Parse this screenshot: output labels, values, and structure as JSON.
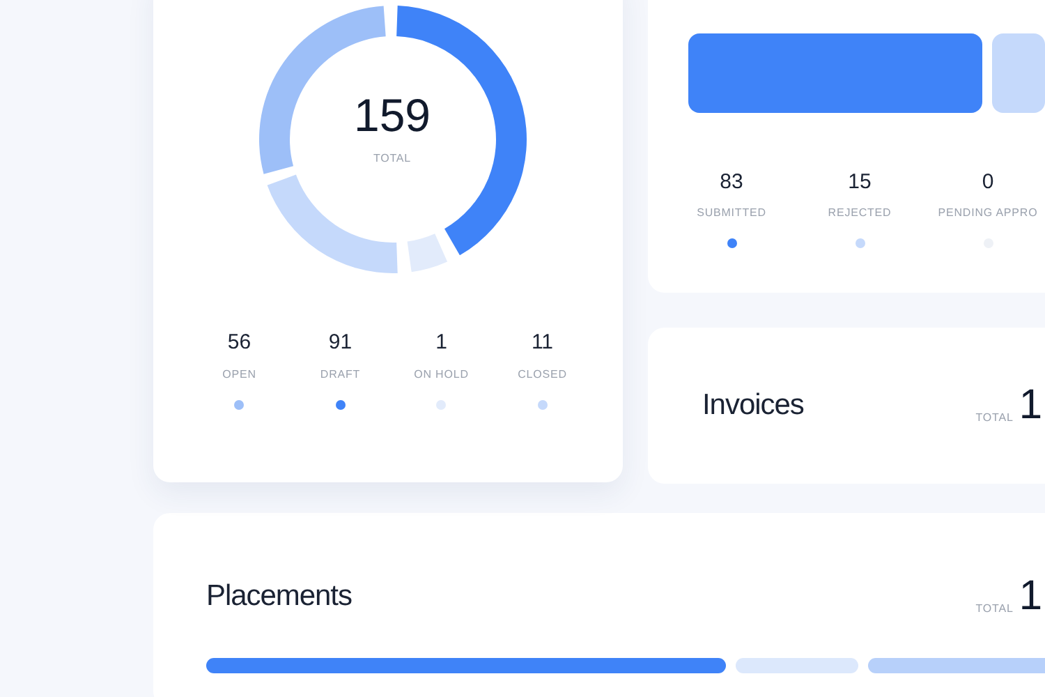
{
  "status_card": {
    "total": "159",
    "total_label": "TOTAL",
    "legend": [
      {
        "value": "56",
        "label": "OPEN",
        "color": "#9dbff8"
      },
      {
        "value": "91",
        "label": "DRAFT",
        "color": "#3f83f8"
      },
      {
        "value": "1",
        "label": "ON HOLD",
        "color": "#e2ebfb"
      },
      {
        "value": "11",
        "label": "CLOSED",
        "color": "#c5d9fb"
      }
    ]
  },
  "submissions_card": {
    "stats": [
      {
        "value": "83",
        "label": "SUBMITTED",
        "color": "#3f83f8"
      },
      {
        "value": "15",
        "label": "REJECTED",
        "color": "#c5d9fb"
      },
      {
        "value": "0",
        "label": "PENDING APPRO",
        "color": "#eef1f6"
      }
    ]
  },
  "invoices_card": {
    "title": "Invoices",
    "total_label": "TOTAL",
    "total": "1"
  },
  "placements_card": {
    "title": "Placements",
    "total_label": "TOTAL",
    "total": "1"
  }
}
